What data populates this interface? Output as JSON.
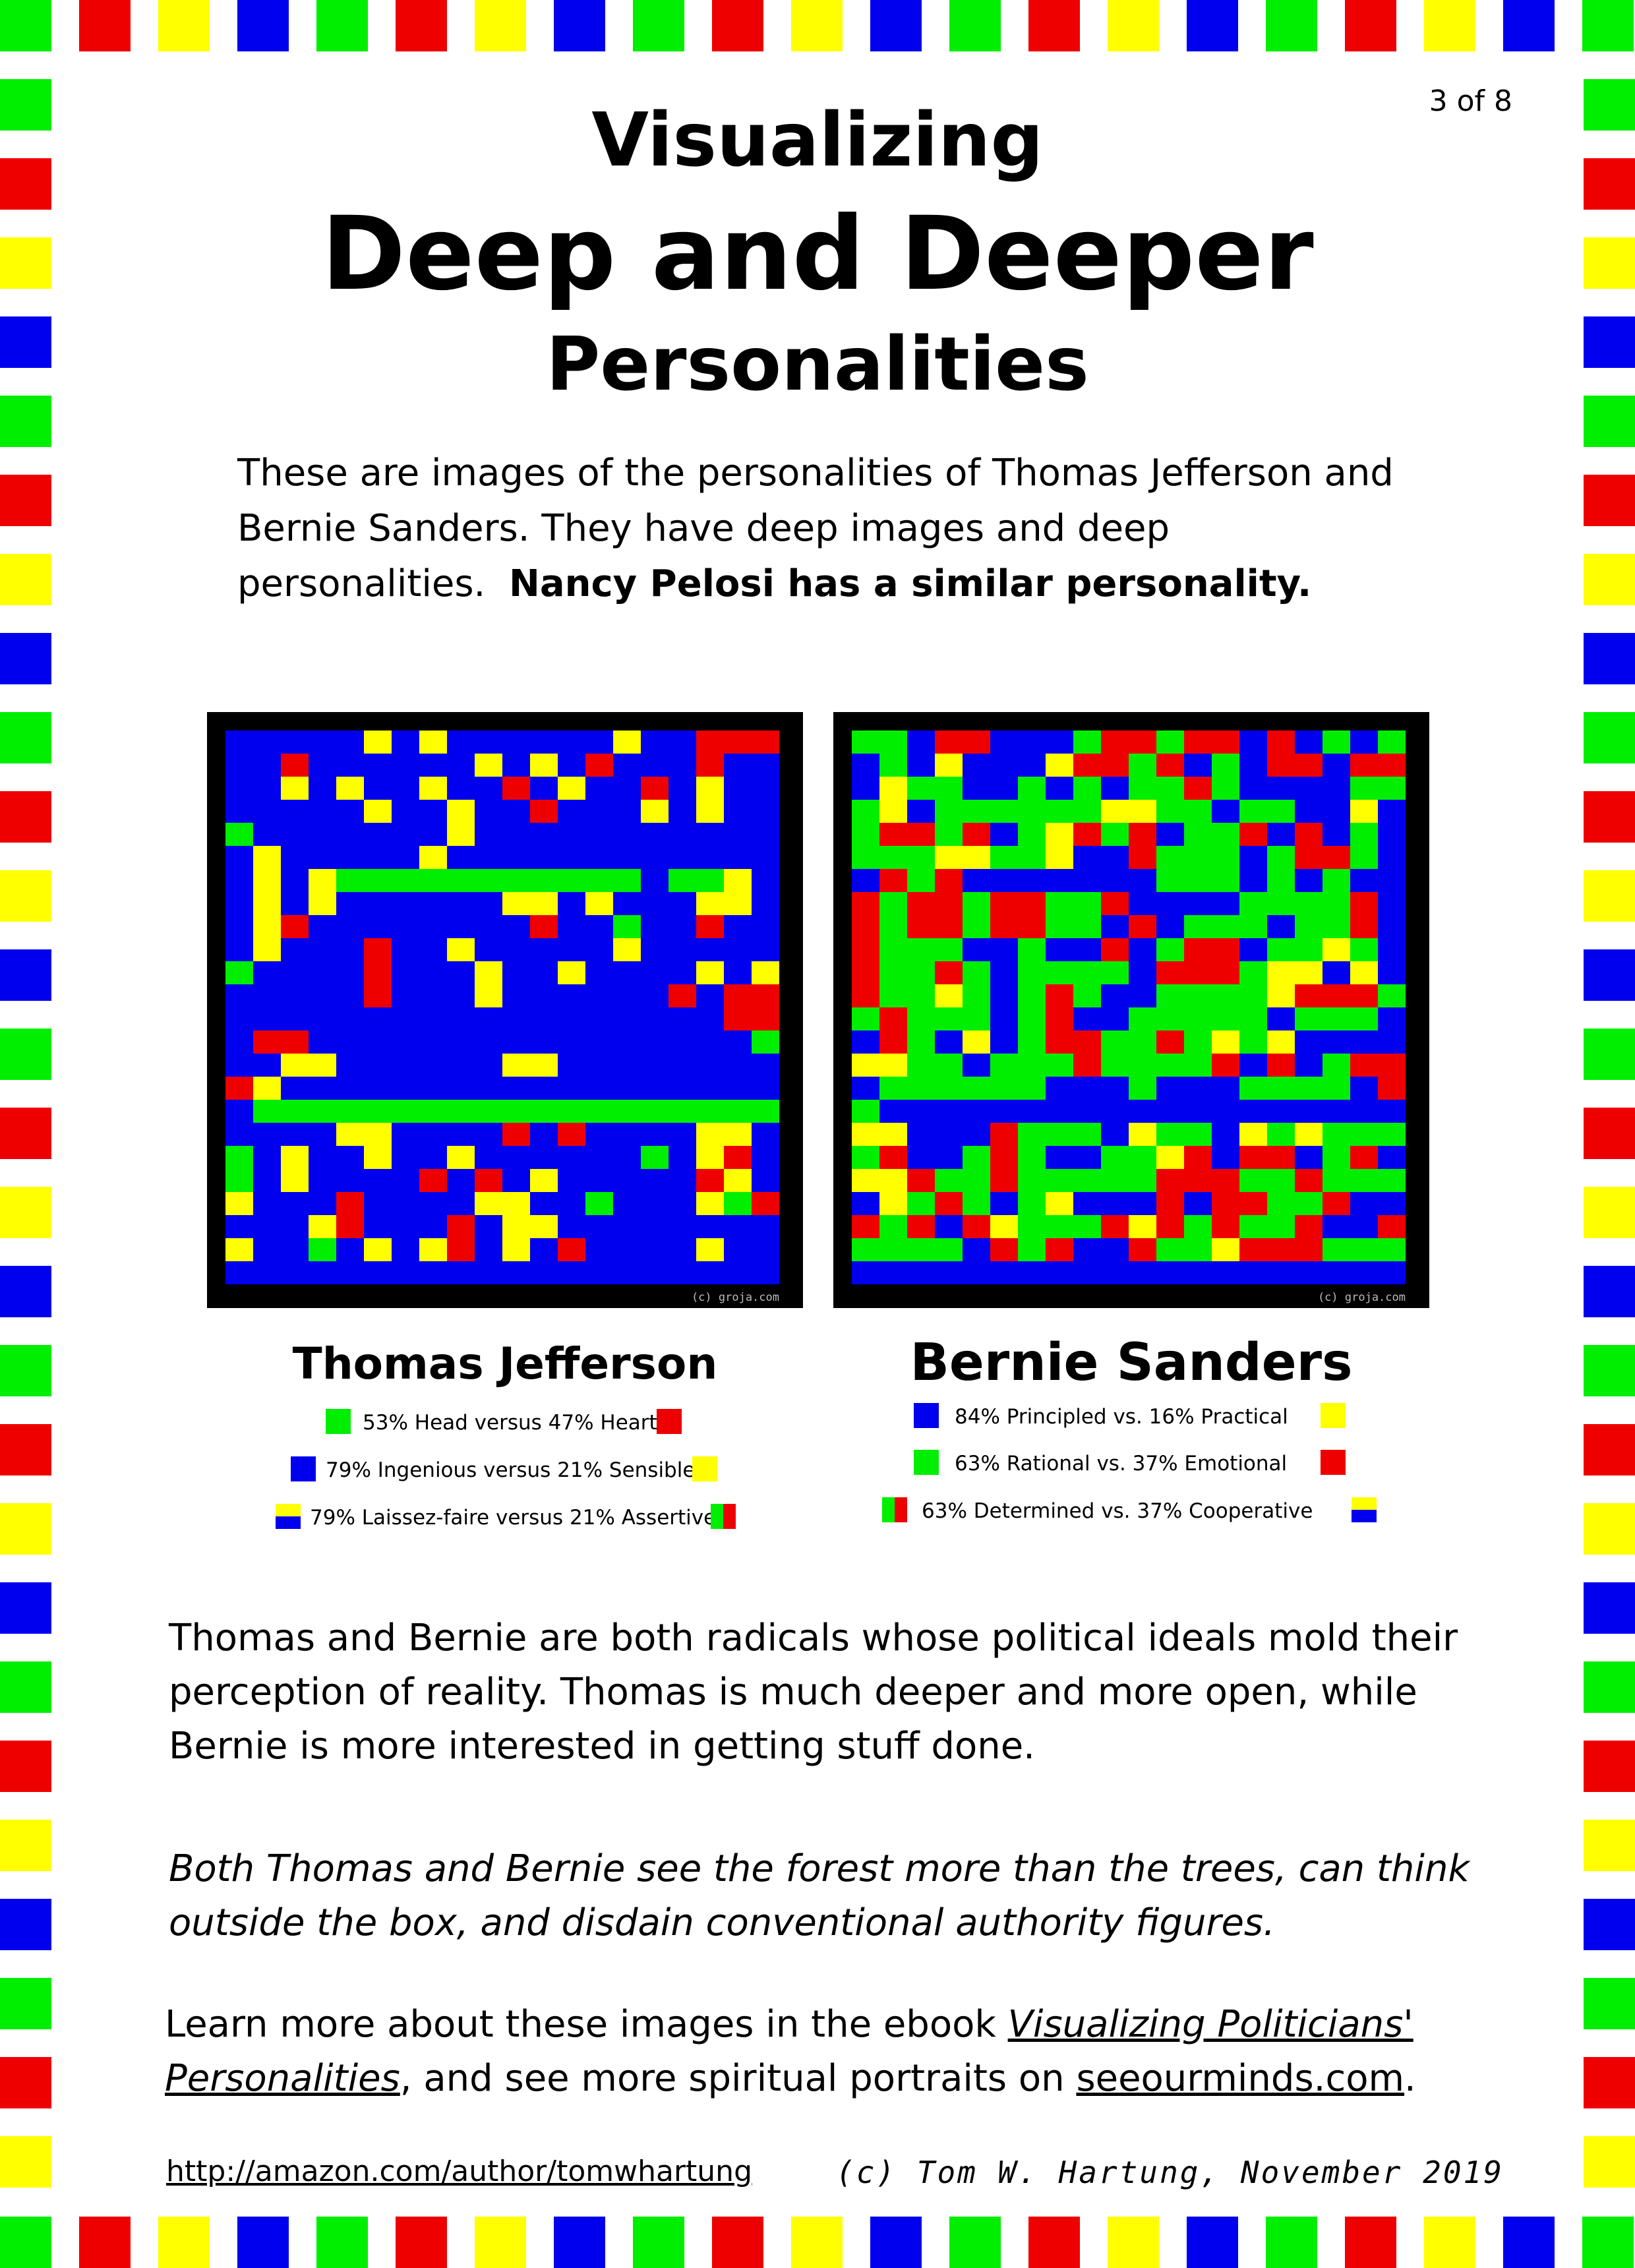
{
  "page_number": "3 of 8",
  "title": {
    "line1": "Visualizing",
    "line2": "Deep and Deeper",
    "line3": "Personalities"
  },
  "intro": {
    "text": "These are images of the personalities of Thomas Jefferson and Bernie Sanders.  They have deep images and deep personalities.",
    "bold": "Nancy Pelosi has a similar personality."
  },
  "portraits": {
    "watermark": "(c) groja.com",
    "jefferson": {
      "name": "Thomas Jefferson",
      "rows": [
        "BBBBBYBYBBBBBBYBBRRR",
        "BBRBBBBBBYBYBRBBBRBB",
        "BBYBYBBYBBRBYBBRBYBB",
        "BBBBBYBBYBBRBBBYBYBB",
        "GBBBBBBBYBBBBBBBBBBB",
        "BYBBBBBYBBBBBBBBBBBB",
        "BYBYGGGGGGGGGGGBGGYB",
        "BYBYBBBBBBYYBYBBBYYB",
        "BYRBBBBBBBBRBBGBBRBB",
        "BYBBBRBBYBBBBBYBBBBB",
        "GBBBBRBBBYBBYBBBBYBY",
        "BBBBBRBBBYBBBBBBRBRR",
        "BBBBBBBBBBBBBBBBBBRR",
        "BRRBBBBBBBBBBBBBBBBG",
        "BBYYBBBBBBYYBBBBBBBB",
        "RYBBBBBBBBBBBBBBBBBB",
        "BGGGGGGGGGGGGGGGGGGG",
        "BBBBYYBBBBRBRBBBBYYB",
        "GBYBBYBBYBBBBBBGBYRB",
        "GBYBBBBRBRBYBBBBBRYB",
        "YBBBRBBBBYYBBGBBBYGR",
        "BBBYRBBBRBYYBBBBBBBB",
        "YBBGBYBYRBYBRBBBBYBB",
        "BBBBBBBBBBBBBBBBBBBB"
      ]
    },
    "sanders": {
      "name": "Bernie Sanders",
      "rows": [
        "GGBRRBBBGRRGRRBRBGBG",
        "BGBYBBBYRRGRBGBRRBRR",
        "BYGGBBGBGBGGRGBBBBGG",
        "GYBGGGGGGYYGGBGGBBYB",
        "GRRGRBGYRGRBGGRBRBGB",
        "GGGYYGGYBBRGGGBGRRGB",
        "BRGRBBBBBBBGGGBGBGBB",
        "RGRRGRRGGRBBBBGGGGRB",
        "RGRRGRRGGBRBGGGBGGRB",
        "RGGGBBGBBRBGRRBGGYGB",
        "RGGRGBGGGGBRRRGYYBYB",
        "RGGYGBGRGBBGGGGYRRRG",
        "GRGGGBGRBBGGGGGBGGGB",
        "BRGBYBGRRGGRGYGYBBBB",
        "YYGGBGGGRGGGGRBRBGRR",
        "BGGGGGGBBBGBBBGGGGBR",
        "GBBBBBBBBBBBBBBBBBBB",
        "YYBBBRGGGBYGGBYGYGGG",
        "GRBBGRGBBGGYRBRRBGRB",
        "YYRGGRGGGGGRRRGGRGGG",
        "BYGRGBGYBBBRBRRGGRBB",
        "RGRBRYGGGRYRGRGGRBBR",
        "GGGGBRGRBBRGGYRRRGGG",
        "BBBBBBBBBBBBBBBBBBBB"
      ]
    }
  },
  "legend": {
    "jefferson": [
      {
        "text": "53% Head versus 47% Heart",
        "left_color": "#00ee00",
        "right_color": "#ee0000"
      },
      {
        "text": "79% Ingenious versus 21% Sensible",
        "left_color": "#0000ee",
        "right_color": "#ffff00"
      },
      {
        "text": "79% Laissez-faire versus 21% Assertive",
        "left_color": "#0000ee",
        "right_color": "#ffff00"
      }
    ],
    "sanders": [
      {
        "text": "84% Principled vs. 16% Practical",
        "left_color": "#0000ee",
        "right_color": "#ffff00"
      },
      {
        "text": "63% Rational vs. 37% Emotional",
        "left_color": "#00ee00",
        "right_color": "#ee0000"
      },
      {
        "text": "63% Determined vs. 37% Cooperative",
        "left_color": "#00ee00",
        "right_color": "#0000ee"
      }
    ]
  },
  "paragraphs": {
    "p1": "Thomas and Bernie are both radicals whose political ideals mold their perception of reality.  Thomas is much deeper and more open, while Bernie is more interested in getting stuff done.",
    "p2": "Both Thomas and Bernie see the forest more than the trees, can think outside the box, and disdain conventional authority figures.",
    "p3": {
      "before": "Learn more about these images in the ebook ",
      "book": "Visualizing Politicians' Personalities",
      "middle": ", and see more spiritual portraits on ",
      "site": "seeourminds.com",
      "after": "."
    }
  },
  "footer": {
    "link": "http://amazon.com/author/tomwhartung",
    "copyright": "(c) Tom W. Hartung, November 2019"
  },
  "colors": {
    "G": "#00ee00",
    "R": "#ee0000",
    "Y": "#ffff00",
    "B": "#0000ee"
  },
  "border_pattern": [
    "green",
    "red",
    "yellow",
    "blue"
  ]
}
